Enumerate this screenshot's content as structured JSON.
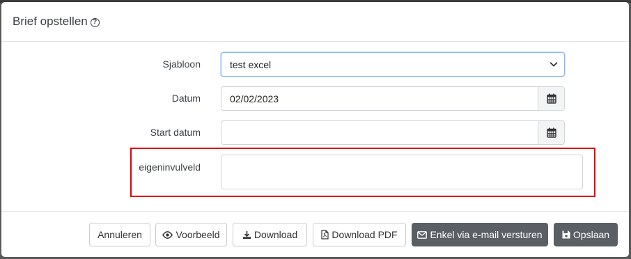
{
  "modal": {
    "title": "Brief opstellen",
    "help_icon": "question-circle-icon"
  },
  "form": {
    "sjabloon": {
      "label": "Sjabloon",
      "value": "test excel",
      "icon": "chevron-down-icon"
    },
    "datum": {
      "label": "Datum",
      "value": "02/02/2023",
      "icon": "calendar-icon"
    },
    "start_datum": {
      "label": "Start datum",
      "value": "",
      "icon": "calendar-icon"
    },
    "eigeninvulveld": {
      "label": "eigeninvulveld",
      "value": ""
    }
  },
  "footer": {
    "cancel": "Annuleren",
    "preview": "Voorbeeld",
    "download": "Download",
    "download_pdf": "Download PDF",
    "email": "Enkel via e-mail versturen",
    "save": "Opslaan"
  },
  "colors": {
    "highlight": "#e00000",
    "dark_button": "#5a5f66",
    "focus_border": "#86b7fe"
  }
}
